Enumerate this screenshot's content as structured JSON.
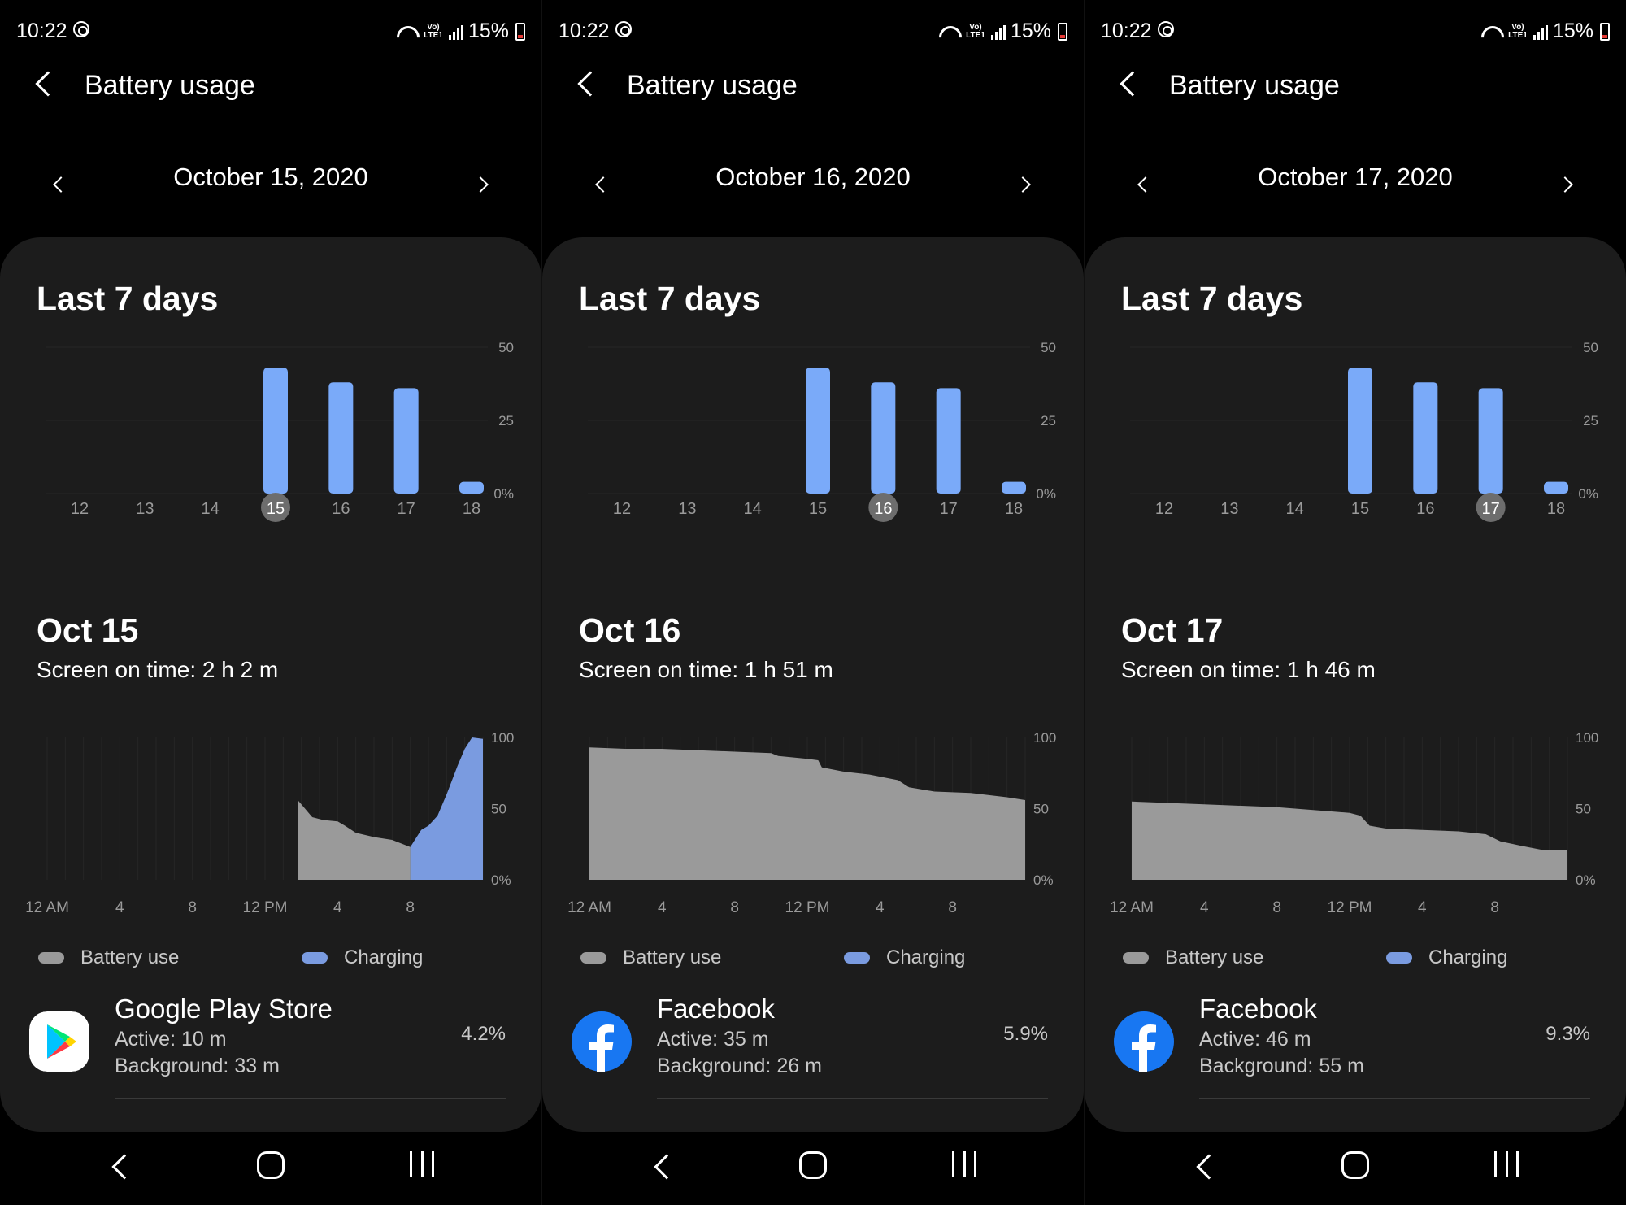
{
  "status_bar": {
    "time": "10:22",
    "battery_text": "15%",
    "network_label": "Vo) LTE1"
  },
  "colors": {
    "bar": "#7aaaf9",
    "battery_use": "#9a9a9a",
    "charging": "#7a9be0",
    "selected_day": "#6d6d6d",
    "card": "#1c1c1c"
  },
  "panels": [
    {
      "app_title": "Battery usage",
      "date": "October 15, 2020",
      "last7_title": "Last 7 days",
      "day_title": "Oct 15",
      "screen_on_time": "Screen on time: 2 h 2 m",
      "legend": {
        "battery_use": "Battery use",
        "charging": "Charging"
      },
      "app": {
        "name": "Google Play Store",
        "icon": "google-play-icon",
        "active": "Active: 10 m",
        "background": "Background: 33 m",
        "percent": "4.2%"
      }
    },
    {
      "app_title": "Battery usage",
      "date": "October 16, 2020",
      "last7_title": "Last 7 days",
      "day_title": "Oct 16",
      "screen_on_time": "Screen on time: 1 h 51 m",
      "legend": {
        "battery_use": "Battery use",
        "charging": "Charging"
      },
      "app": {
        "name": "Facebook",
        "icon": "facebook-icon",
        "active": "Active: 35 m",
        "background": "Background: 26 m",
        "percent": "5.9%"
      }
    },
    {
      "app_title": "Battery usage",
      "date": "October 17, 2020",
      "last7_title": "Last 7 days",
      "day_title": "Oct 17",
      "screen_on_time": "Screen on time: 1 h 46 m",
      "legend": {
        "battery_use": "Battery use",
        "charging": "Charging"
      },
      "app": {
        "name": "Facebook",
        "icon": "facebook-icon",
        "active": "Active: 46 m",
        "background": "Background: 55 m",
        "percent": "9.3%"
      }
    }
  ],
  "chart_data": [
    {
      "type": "bar",
      "categories": [
        "12",
        "13",
        "14",
        "15",
        "16",
        "17",
        "18"
      ],
      "values": [
        0,
        43,
        38,
        36,
        4
      ],
      "all_values": [
        0,
        0,
        0,
        43,
        38,
        36,
        4
      ],
      "yticks": [
        "50",
        "25",
        "0%"
      ],
      "ylim": [
        0,
        50
      ],
      "selected": [
        "15",
        "16",
        "17"
      ],
      "note_values_per_day": {
        "12": 0,
        "13": 0,
        "14": 0,
        "15": 43,
        "16": 38,
        "17": 36,
        "18": 4
      }
    },
    {
      "type": "area",
      "xticks": [
        "12 AM",
        "4",
        "8",
        "12 PM",
        "4",
        "8"
      ],
      "yticks": [
        "100",
        "50",
        "0%"
      ],
      "ylim": [
        0,
        100
      ],
      "xlim": [
        0,
        24
      ],
      "series": [
        {
          "x": [
            0,
            24
          ],
          "battery": [
            [
              [
                13.8,
                56
              ],
              [
                14.2,
                50
              ],
              [
                14.6,
                44
              ],
              [
                15.2,
                42
              ],
              [
                16,
                41
              ],
              [
                16.4,
                38
              ],
              [
                17,
                33
              ],
              [
                18,
                30
              ],
              [
                19,
                28
              ],
              [
                20,
                23
              ]
            ],
            [
              [
                0,
                93
              ],
              [
                2,
                92
              ],
              [
                4,
                92
              ],
              [
                6,
                91
              ],
              [
                8,
                90
              ],
              [
                10,
                89
              ],
              [
                10.4,
                87
              ],
              [
                12,
                85
              ],
              [
                12.6,
                84
              ],
              [
                12.8,
                79
              ],
              [
                14,
                76
              ],
              [
                15.4,
                74
              ],
              [
                17,
                70
              ],
              [
                17.6,
                65
              ],
              [
                19,
                62
              ],
              [
                21,
                61
              ],
              [
                23,
                58
              ],
              [
                24,
                56
              ]
            ],
            [
              [
                0,
                55
              ],
              [
                4,
                53
              ],
              [
                8,
                51
              ],
              [
                10,
                49
              ],
              [
                12,
                47
              ],
              [
                12.6,
                45
              ],
              [
                13.1,
                38
              ],
              [
                14,
                36
              ],
              [
                16,
                35
              ],
              [
                18,
                34
              ],
              [
                19.5,
                32
              ],
              [
                20.3,
                27
              ],
              [
                21.4,
                24
              ],
              [
                22.6,
                21
              ],
              [
                24,
                21
              ]
            ]
          ],
          "charging": [
            [
              [
                20,
                23
              ],
              [
                20.6,
                35
              ],
              [
                21,
                38
              ],
              [
                21.5,
                45
              ],
              [
                22,
                60
              ],
              [
                22.6,
                80
              ],
              [
                23,
                92
              ],
              [
                23.4,
                100
              ],
              [
                24,
                99
              ]
            ],
            [],
            []
          ]
        }
      ]
    }
  ]
}
